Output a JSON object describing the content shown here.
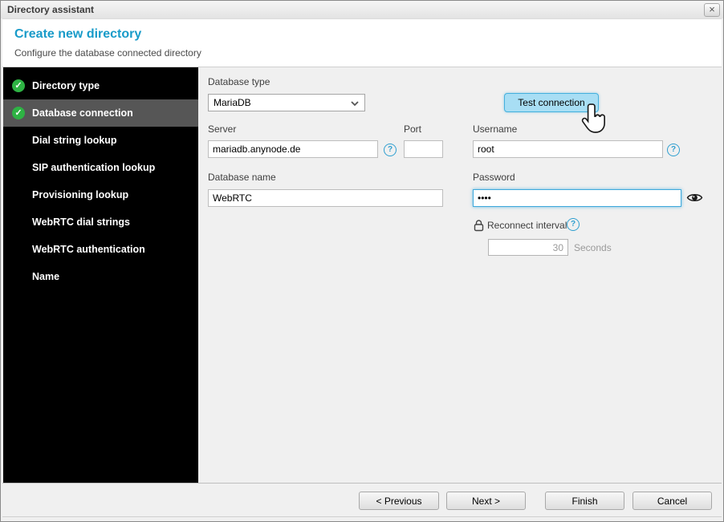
{
  "window": {
    "title": "Directory assistant"
  },
  "icons": {
    "close": "×",
    "check": "✓",
    "help": "?"
  },
  "header": {
    "title": "Create new directory",
    "subtitle": "Configure the database connected directory"
  },
  "wizard": {
    "steps": [
      {
        "label": "Directory type",
        "completed": true,
        "active": false
      },
      {
        "label": "Database connection",
        "completed": true,
        "active": true
      },
      {
        "label": "Dial string lookup",
        "completed": false,
        "active": false
      },
      {
        "label": "SIP authentication lookup",
        "completed": false,
        "active": false
      },
      {
        "label": "Provisioning lookup",
        "completed": false,
        "active": false
      },
      {
        "label": "WebRTC dial strings",
        "completed": false,
        "active": false
      },
      {
        "label": "WebRTC authentication",
        "completed": false,
        "active": false
      },
      {
        "label": "Name",
        "completed": false,
        "active": false
      }
    ]
  },
  "form": {
    "database_type": {
      "label": "Database type",
      "value": "MariaDB"
    },
    "test_connection_label": "Test connection",
    "server": {
      "label": "Server",
      "value": "mariadb.anynode.de"
    },
    "port": {
      "label": "Port",
      "value": ""
    },
    "username": {
      "label": "Username",
      "value": "root"
    },
    "database_name": {
      "label": "Database name",
      "value": "WebRTC"
    },
    "password": {
      "label": "Password",
      "value": "••••"
    },
    "reconnect": {
      "label": "Reconnect interval",
      "value": "30",
      "unit": "Seconds"
    }
  },
  "footer": {
    "previous_label": "< Previous",
    "next_label": "Next >",
    "finish_label": "Finish",
    "cancel_label": "Cancel"
  },
  "colors": {
    "accent_cyan": "#189bc9",
    "check_green": "#2eb344",
    "test_button_bg": "#a8def4",
    "test_button_border": "#45b0dd",
    "focus_blue": "#3fa9dc",
    "sidebar_bg": "#000000",
    "sidebar_active_bg": "#565656"
  }
}
